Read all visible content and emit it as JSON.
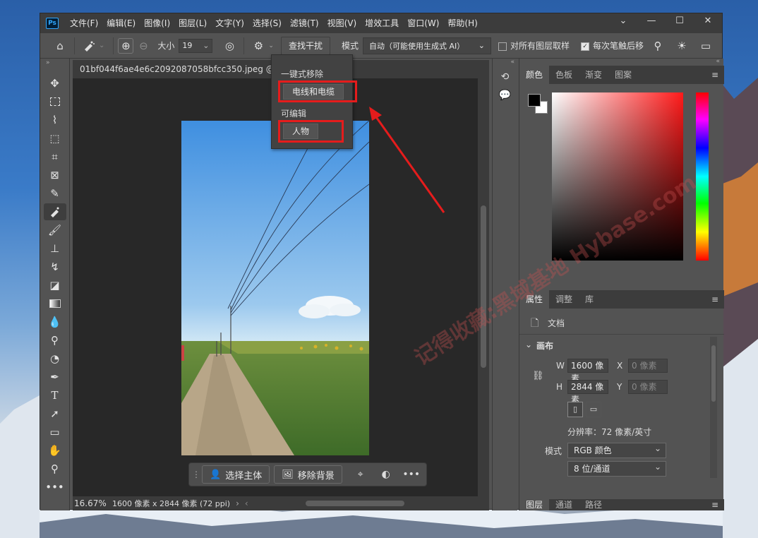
{
  "menubar": {
    "logo": "Ps",
    "items": [
      "文件(F)",
      "编辑(E)",
      "图像(I)",
      "图层(L)",
      "文字(Y)",
      "选择(S)",
      "滤镜(T)",
      "视图(V)",
      "增效工具",
      "窗口(W)",
      "帮助(H)"
    ],
    "controls": [
      "⌄",
      "—",
      "☐",
      "✕"
    ]
  },
  "options": {
    "size_label": "大小",
    "size_value": "19",
    "find_button": "查找干扰",
    "mode_label": "模式",
    "mode_value": "自动（可能使用生成式 AI）",
    "sample_all_label": "对所有图层取样",
    "each_stroke_label": "每次笔触后移"
  },
  "document": {
    "tab_title": "01bf044f6ae4e6c2092087058bfcc350.jpeg @ 16.7%",
    "zoom": "16.67%",
    "info": "1600 像素 x 2844 像素 (72 ppi)"
  },
  "dropdown": {
    "group1": "一键式移除",
    "item1": "电线和电缆",
    "group2": "可编辑",
    "item2": "人物"
  },
  "context_bar": {
    "select_subject": "选择主体",
    "remove_bg": "移除背景",
    "more": "•••"
  },
  "color_panel": {
    "tabs": [
      "颜色",
      "色板",
      "渐变",
      "图案"
    ],
    "foreground": "#000000",
    "background": "#ffffff"
  },
  "properties_panel": {
    "tabs": [
      "属性",
      "调整",
      "库"
    ],
    "doc_label": "文档",
    "section": "画布",
    "w_label": "W",
    "w_value": "1600 像素",
    "h_label": "H",
    "h_value": "2844 像素",
    "x_label": "X",
    "x_placeholder": "0 像素",
    "y_label": "Y",
    "y_placeholder": "0 像素",
    "resolution": "分辨率：72 像素/英寸",
    "mode_label": "模式",
    "mode_value": "RGB 颜色",
    "depth_value": "8 位/通道"
  },
  "layers_panel": {
    "tabs": [
      "图层",
      "通道",
      "路径"
    ]
  },
  "watermark": "记得收藏:黑域基地 Hybase.com",
  "colors": {
    "highlight": "#e51c1c",
    "ui_dark": "#3c3c3c",
    "ui_mid": "#535353"
  }
}
